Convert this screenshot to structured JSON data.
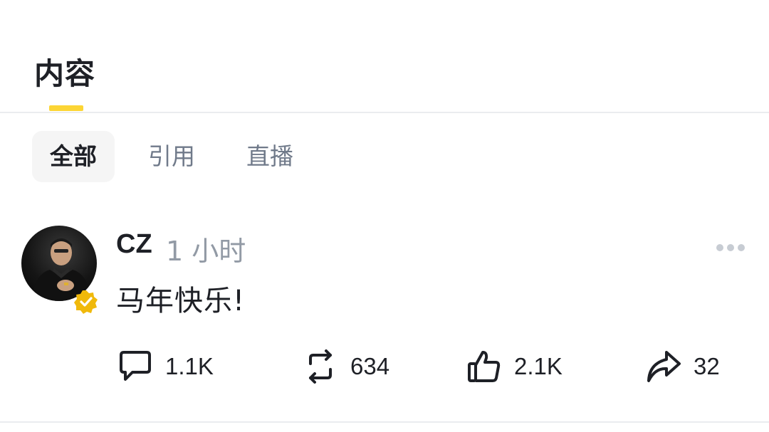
{
  "header": {
    "tab_label": "内容",
    "accent_color": "#fcd535"
  },
  "filters": [
    {
      "label": "全部",
      "active": true
    },
    {
      "label": "引用",
      "active": false
    },
    {
      "label": "直播",
      "active": false
    }
  ],
  "post": {
    "author": "CZ",
    "time": "1 小时",
    "verified": true,
    "text": "马年快乐!",
    "stats": {
      "comments": "1.1K",
      "reposts": "634",
      "likes": "2.1K",
      "shares": "32"
    }
  },
  "icons": {
    "more": "more-dots-icon",
    "comment": "comment-icon",
    "repost": "repost-icon",
    "like": "thumbs-up-icon",
    "share": "share-icon",
    "verified": "verified-badge-icon"
  }
}
